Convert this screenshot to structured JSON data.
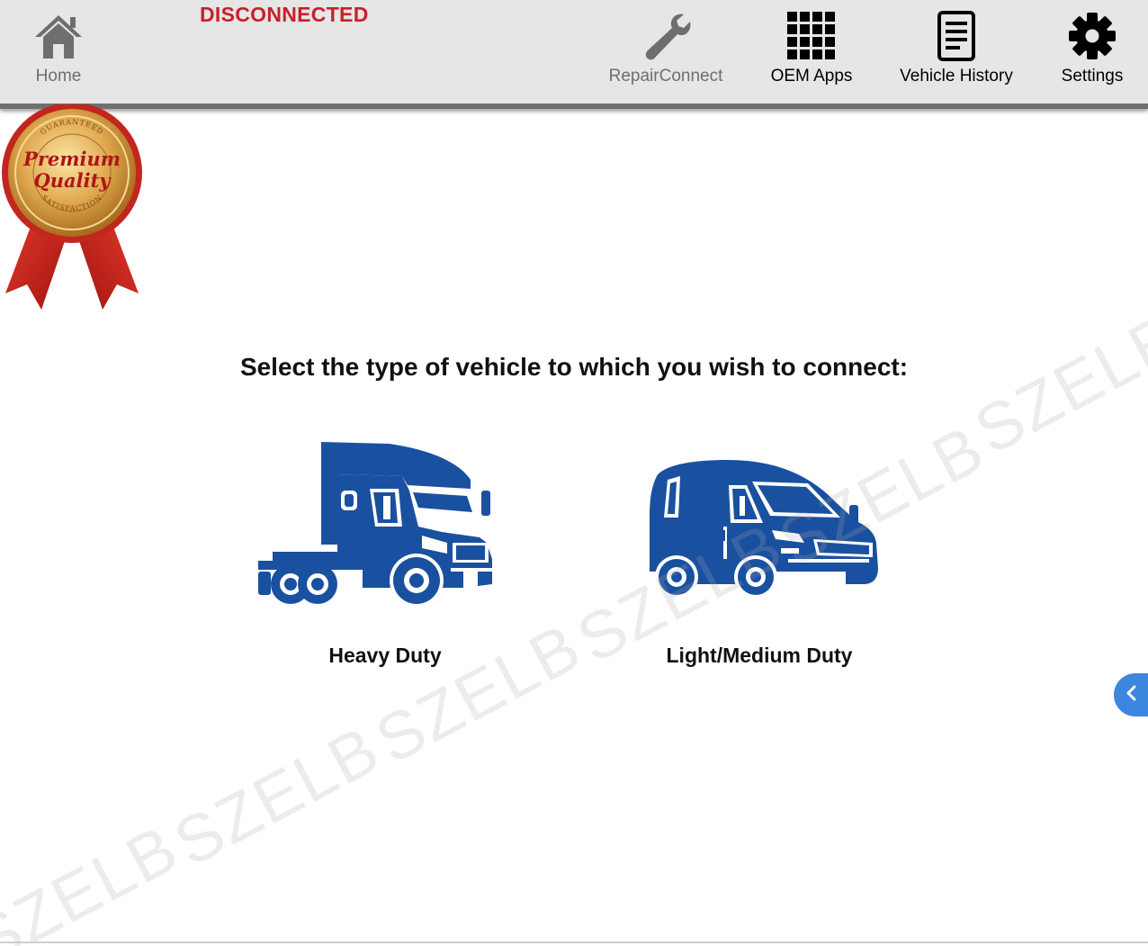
{
  "header": {
    "status": "DISCONNECTED",
    "nav": {
      "home": "Home",
      "repair_connect": "RepairConnect",
      "oem_apps": "OEM Apps",
      "vehicle_history": "Vehicle History",
      "settings": "Settings"
    }
  },
  "badge": {
    "line1": "Premium",
    "line2": "Quality",
    "arc_top": "GUARANTEED",
    "arc_bottom": "SATISFACTION"
  },
  "main": {
    "prompt": "Select the type of vehicle to which you wish to connect:",
    "options": [
      {
        "label": "Heavy Duty",
        "icon": "semi-truck-icon"
      },
      {
        "label": "Light/Medium Duty",
        "icon": "van-icon"
      }
    ]
  },
  "watermark": "SZELB",
  "colors": {
    "accent_blue": "#1a50a0",
    "status_red": "#c8202a",
    "side_tab_blue": "#3d86e0",
    "topbar_bg": "#e6e6e6"
  }
}
